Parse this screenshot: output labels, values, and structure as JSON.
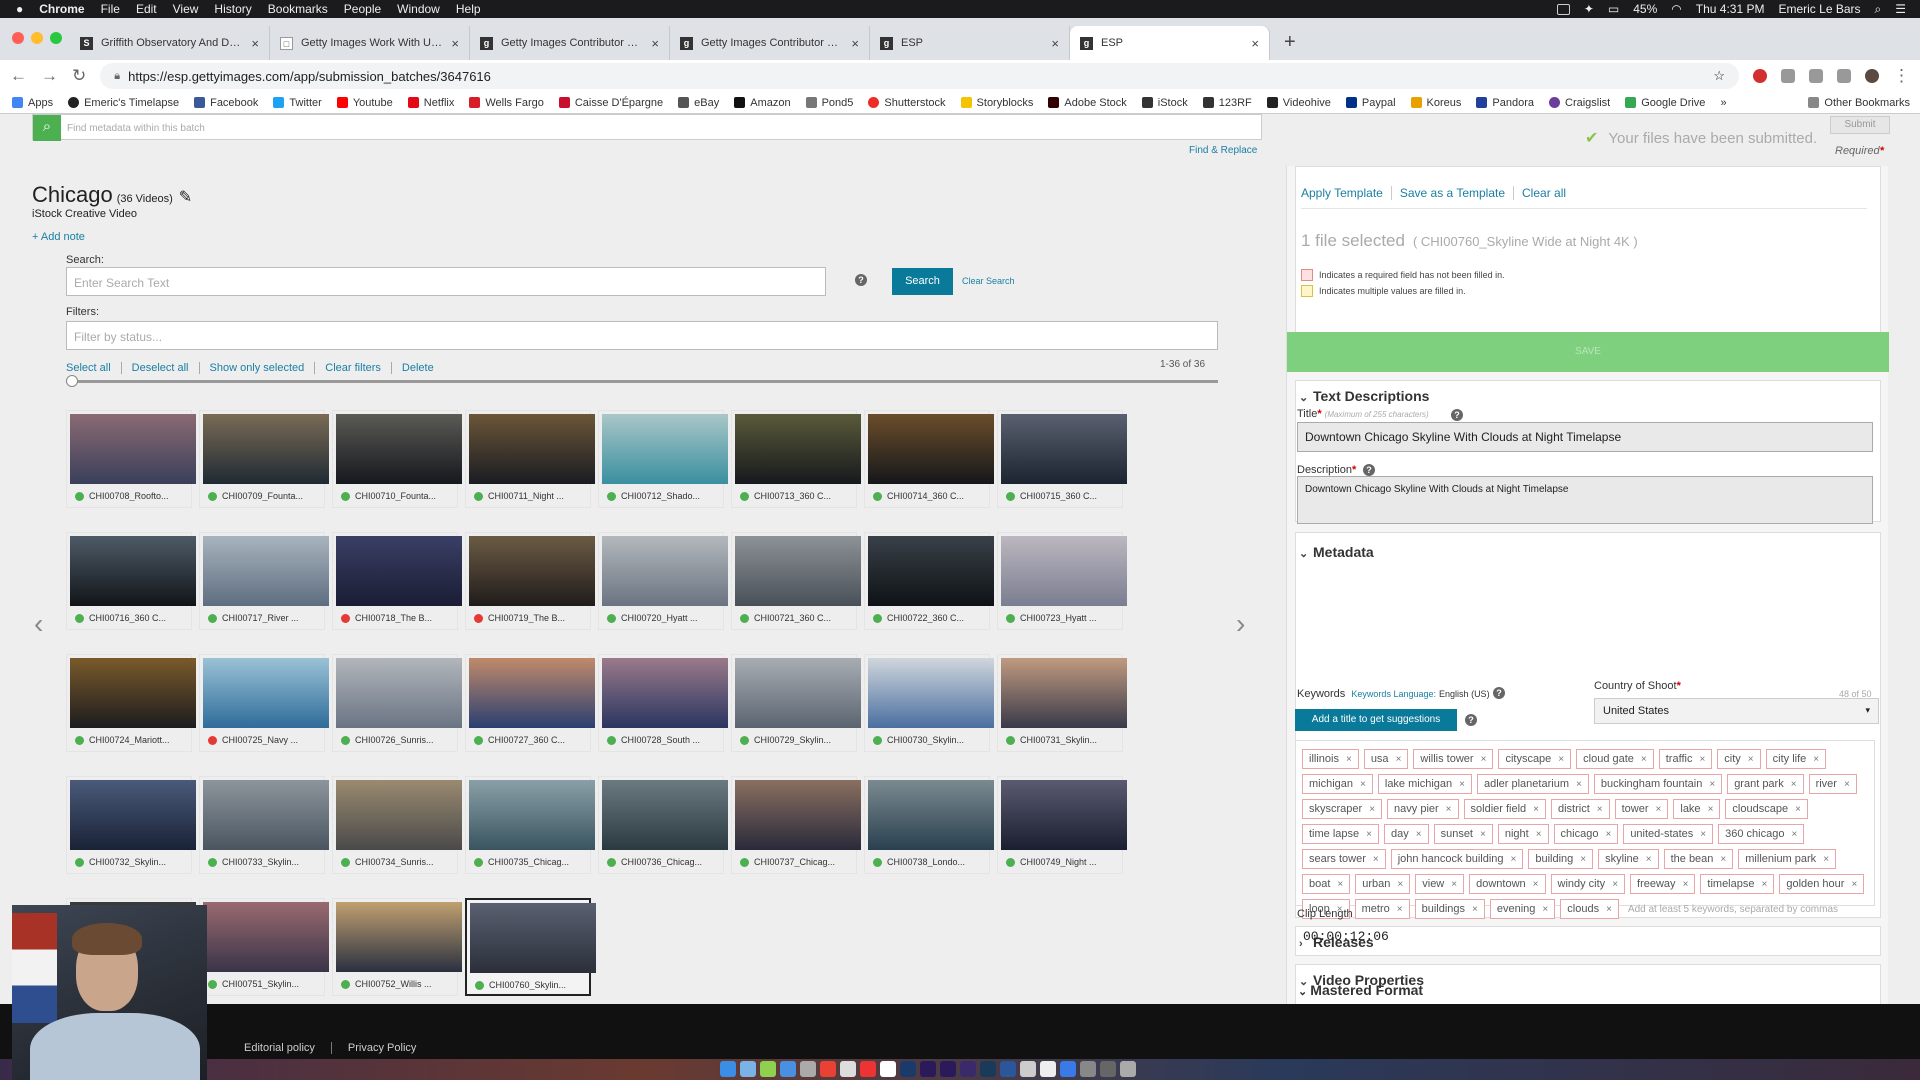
{
  "menubar": {
    "app": "Chrome",
    "items": [
      "File",
      "Edit",
      "View",
      "History",
      "Bookmarks",
      "People",
      "Window",
      "Help"
    ],
    "battery": "45%",
    "clock": "Thu 4:31 PM",
    "user": "Emeric Le Bars"
  },
  "tabs": [
    {
      "title": "Griffith Observatory And Down",
      "fav": "S"
    },
    {
      "title": "Getty Images Work With Us | F",
      "fav": "□"
    },
    {
      "title": "Getty Images Contributor Com",
      "fav": "g"
    },
    {
      "title": "Getty Images Contributor Com",
      "fav": "g"
    },
    {
      "title": "ESP",
      "fav": "g"
    },
    {
      "title": "ESP",
      "fav": "g"
    }
  ],
  "omnibox": {
    "url": "https://esp.gettyimages.com/app/submission_batches/3647616"
  },
  "bookmarks": [
    "Apps",
    "Emeric's Timelapse",
    "Facebook",
    "Twitter",
    "Youtube",
    "Netflix",
    "Wells Fargo",
    "Caisse D'Épargne",
    "eBay",
    "Amazon",
    "Pond5",
    "Shutterstock",
    "Storyblocks",
    "Adobe Stock",
    "iStock",
    "123RF",
    "Videohive",
    "Paypal",
    "Koreus",
    "Pandora",
    "Craigslist",
    "Google Drive"
  ],
  "bookmarks_more": "»",
  "bookmarks_other": "Other Bookmarks",
  "metadata_search": {
    "placeholder": "Find metadata within this batch",
    "find_replace": "Find & Replace"
  },
  "submit": {
    "label": "Submit",
    "toast": "Your files have been submitted.",
    "required": "Required"
  },
  "batch": {
    "title": "Chicago",
    "count": "(36 Videos)",
    "subtitle": "iStock Creative Video",
    "add_note": "+ Add note"
  },
  "search": {
    "label": "Search:",
    "placeholder": "Enter Search Text",
    "button": "Search",
    "clear": "Clear Search"
  },
  "filters": {
    "label": "Filters:",
    "placeholder": "Filter by status..."
  },
  "actions": [
    "Select all",
    "Deselect all",
    "Show only selected",
    "Clear filters",
    "Delete"
  ],
  "result_count": "1-36 of 36",
  "thumbnails": [
    {
      "name": "CHI00708_Roofto...",
      "status": "ok",
      "c1": "#3a3f5a",
      "c2": "#8a6a73"
    },
    {
      "name": "CHI00709_Founta...",
      "status": "ok",
      "c1": "#1f2a33",
      "c2": "#7a6b55"
    },
    {
      "name": "CHI00710_Founta...",
      "status": "ok",
      "c1": "#15181d",
      "c2": "#5b5a55"
    },
    {
      "name": "CHI00711_Night ...",
      "status": "ok",
      "c1": "#1a1c22",
      "c2": "#6b5638"
    },
    {
      "name": "CHI00712_Shado...",
      "status": "ok",
      "c1": "#3a8fa0",
      "c2": "#a9c7c8"
    },
    {
      "name": "CHI00713_360 C...",
      "status": "ok",
      "c1": "#16191d",
      "c2": "#5a5a3a"
    },
    {
      "name": "CHI00714_360 C...",
      "status": "ok",
      "c1": "#15171b",
      "c2": "#6b4d2a"
    },
    {
      "name": "CHI00715_360 C...",
      "status": "ok",
      "c1": "#1b2430",
      "c2": "#5a6070"
    },
    {
      "name": "CHI00716_360 C...",
      "status": "ok",
      "c1": "#111519",
      "c2": "#4d5a66"
    },
    {
      "name": "CHI00717_River ...",
      "status": "ok",
      "c1": "#5e6e80",
      "c2": "#a8b4bd"
    },
    {
      "name": "CHI00718_The B...",
      "status": "err",
      "c1": "#1a1d33",
      "c2": "#3a3f66"
    },
    {
      "name": "CHI00719_The B...",
      "status": "err",
      "c1": "#201c1a",
      "c2": "#6b5b45"
    },
    {
      "name": "CHI00720_Hyatt ...",
      "status": "ok",
      "c1": "#6a7480",
      "c2": "#b4b8bd"
    },
    {
      "name": "CHI00721_360 C...",
      "status": "ok",
      "c1": "#4a5058",
      "c2": "#8c9296"
    },
    {
      "name": "CHI00722_360 C...",
      "status": "ok",
      "c1": "#0e1216",
      "c2": "#3a4048"
    },
    {
      "name": "CHI00723_Hyatt ...",
      "status": "ok",
      "c1": "#7a7e90",
      "c2": "#bcb7c0"
    },
    {
      "name": "CHI00724_Mariott...",
      "status": "ok",
      "c1": "#1c1c1f",
      "c2": "#7a5a2a"
    },
    {
      "name": "CHI00725_Navy ...",
      "status": "err",
      "c1": "#2f6c9a",
      "c2": "#9bc2d6"
    },
    {
      "name": "CHI00726_Sunris...",
      "status": "ok",
      "c1": "#6a7483",
      "c2": "#b2b6bc"
    },
    {
      "name": "CHI00727_360 C...",
      "status": "ok",
      "c1": "#2a3f70",
      "c2": "#c08a6a"
    },
    {
      "name": "CHI00728_South ...",
      "status": "ok",
      "c1": "#2a3560",
      "c2": "#9a7a8a"
    },
    {
      "name": "CHI00729_Skylin...",
      "status": "ok",
      "c1": "#5a6470",
      "c2": "#a8adb3"
    },
    {
      "name": "CHI00730_Skylin...",
      "status": "ok",
      "c1": "#4a6fa0",
      "c2": "#d0d6dc"
    },
    {
      "name": "CHI00731_Skylin...",
      "status": "ok",
      "c1": "#3a3a4a",
      "c2": "#c09a80"
    },
    {
      "name": "CHI00732_Skylin...",
      "status": "ok",
      "c1": "#1a2236",
      "c2": "#4a5a7a"
    },
    {
      "name": "CHI00733_Skylin...",
      "status": "ok",
      "c1": "#4a5560",
      "c2": "#8d959c"
    },
    {
      "name": "CHI00734_Sunris...",
      "status": "ok",
      "c1": "#4a4a4a",
      "c2": "#9a8a70"
    },
    {
      "name": "CHI00735_Chicag...",
      "status": "ok",
      "c1": "#3a5560",
      "c2": "#8aa0a8"
    },
    {
      "name": "CHI00736_Chicag...",
      "status": "ok",
      "c1": "#2a3a40",
      "c2": "#6a7a80"
    },
    {
      "name": "CHI00737_Chicag...",
      "status": "ok",
      "c1": "#2a2a3a",
      "c2": "#8a7060"
    },
    {
      "name": "CHI00738_Londo...",
      "status": "ok",
      "c1": "#2a4050",
      "c2": "#7a8a90"
    },
    {
      "name": "CHI00749_Night ...",
      "status": "ok",
      "c1": "#1a1f30",
      "c2": "#5a5a70"
    },
    {
      "name": "",
      "status": "ok",
      "c1": "#2a2a2a",
      "c2": "#3a3a3a"
    },
    {
      "name": "CHI00751_Skylin...",
      "status": "ok",
      "c1": "#3a3448",
      "c2": "#9a6a70"
    },
    {
      "name": "CHI00752_Willis ...",
      "status": "ok",
      "c1": "#2a3040",
      "c2": "#c0a070"
    },
    {
      "name": "CHI00760_Skylin...",
      "status": "ok",
      "c1": "#2a2f3a",
      "c2": "#5a6070",
      "selected": true
    }
  ],
  "panel": {
    "links": [
      "Apply Template",
      "Save as a Template",
      "Clear all"
    ],
    "files_selected": "1 file selected",
    "file_name": "( CHI00760_Skyline Wide at Night 4K )",
    "legend_required": "Indicates a required field has not been filled in.",
    "legend_multiple": "Indicates multiple values are filled in.",
    "save": "SAVE",
    "text_desc": {
      "heading": "Text Descriptions",
      "title_label": "Title",
      "title_hint": "(Maximum of 255 characters)",
      "title_value": "Downtown Chicago Skyline With Clouds at Night Timelapse",
      "desc_label": "Description",
      "desc_value": "Downtown Chicago Skyline With Clouds at Night Timelapse"
    },
    "metadata": {
      "heading": "Metadata",
      "country_label": "Country of Shoot",
      "country_value": "United States",
      "keywords_label": "Keywords",
      "keywords_lang_label": "Keywords Language:",
      "keywords_lang": "English (US)",
      "keyword_count": "48 of 50",
      "suggest_button": "Add a title to get suggestions",
      "keywords": [
        "illinois",
        "usa",
        "willis tower",
        "cityscape",
        "cloud gate",
        "traffic",
        "city",
        "city life",
        "michigan",
        "lake michigan",
        "adler planetarium",
        "buckingham fountain",
        "grant park",
        "river",
        "skyscraper",
        "navy pier",
        "soldier field",
        "district",
        "tower",
        "lake",
        "cloudscape",
        "time lapse",
        "day",
        "sunset",
        "night",
        "chicago",
        "united-states",
        "360 chicago",
        "sears tower",
        "john hancock building",
        "building",
        "skyline",
        "the bean",
        "millenium park",
        "boat",
        "urban",
        "view",
        "downtown",
        "windy city",
        "freeway",
        "timelapse",
        "golden hour",
        "loop",
        "metro",
        "buildings",
        "evening",
        "clouds"
      ],
      "keywords_placeholder": "Add at least 5 keywords, separated by commas"
    },
    "releases": {
      "heading": "Releases"
    },
    "video_props": {
      "heading": "Video Properties",
      "clip_label": "Clip Length",
      "clip_value": "00:00:12:06"
    },
    "mastered": {
      "heading": "Mastered Format"
    }
  },
  "footer": {
    "links": [
      "Editorial policy",
      "Privacy Policy"
    ]
  },
  "colors": {
    "accent": "#0a7a9a",
    "link": "#1a7fa3",
    "save_green": "#7ed07e",
    "ok": "#4caf50",
    "error": "#e53935"
  }
}
